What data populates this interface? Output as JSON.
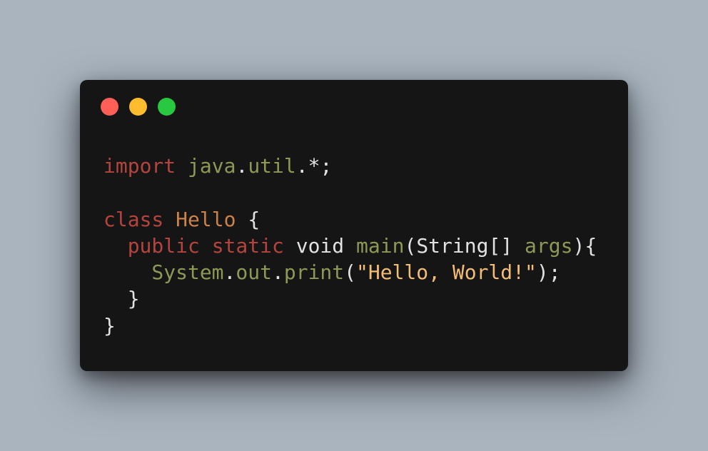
{
  "window": {
    "controls": [
      {
        "name": "close",
        "color": "#ff5f57"
      },
      {
        "name": "minimize",
        "color": "#febc2e"
      },
      {
        "name": "maximize",
        "color": "#28c840"
      }
    ]
  },
  "colors": {
    "keyword": "#b5443f",
    "classname": "#cc8248",
    "identifier": "#8c9a55",
    "string": "#f4bd74",
    "plain": "#e2e2e2"
  },
  "code": {
    "line1": {
      "kw_import": "import",
      "pkg1": "java",
      "dot1": ".",
      "pkg2": "util",
      "rest": ".*;"
    },
    "line3": {
      "kw_class": "class",
      "classname": "Hello",
      "brace": "{"
    },
    "line4": {
      "kw_public": "public",
      "kw_static": "static",
      "kw_void": "void",
      "method": "main",
      "paren_open": "(",
      "type": "String[]",
      "arg": "args",
      "close": "){"
    },
    "line5": {
      "obj": "System",
      "dot1": ".",
      "field": "out",
      "dot2": ".",
      "call": "print",
      "paren_open": "(",
      "str": "\"Hello, World!\"",
      "close": ");"
    },
    "line6": {
      "brace": "}"
    },
    "line7": {
      "brace": "}"
    }
  }
}
